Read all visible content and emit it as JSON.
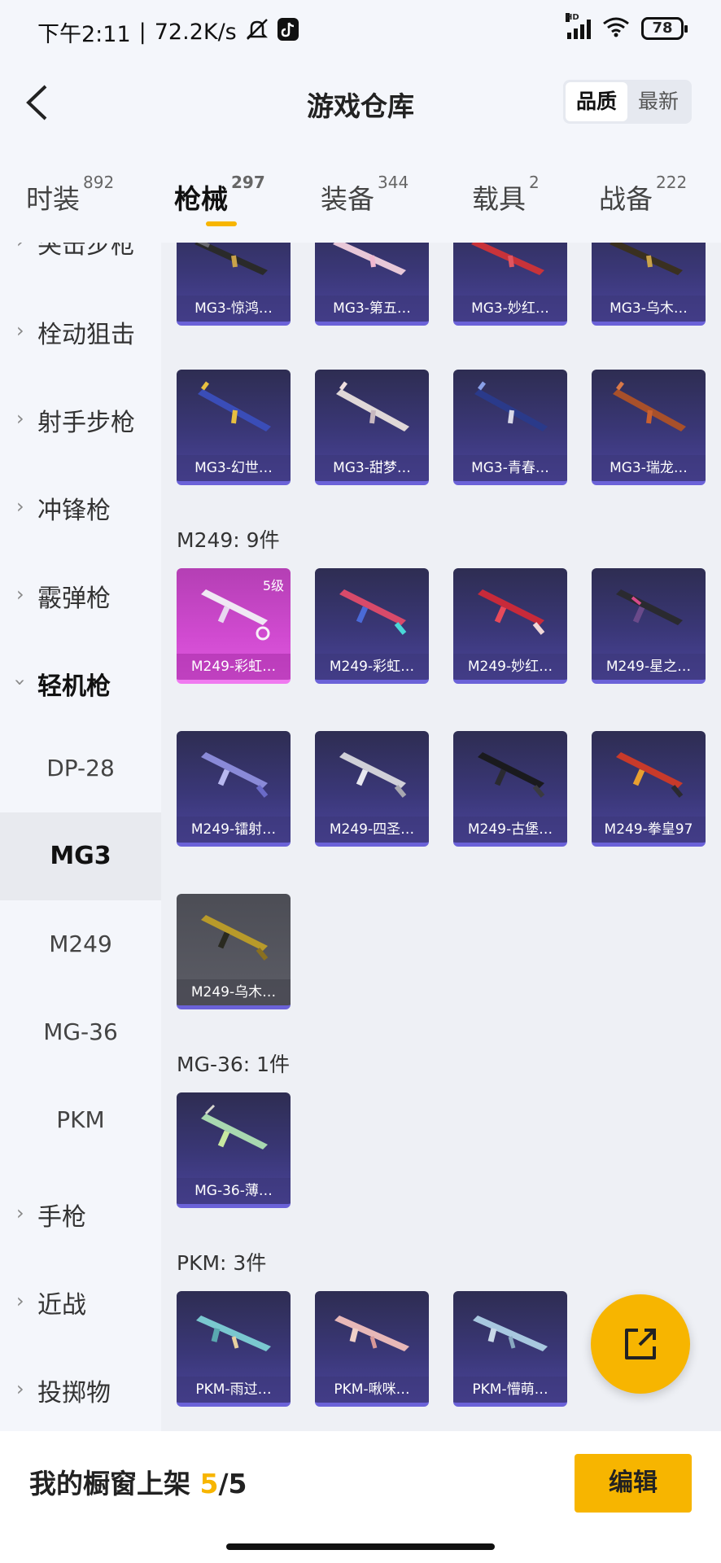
{
  "status": {
    "time": "下午2:11",
    "speed": "72.2K/s",
    "battery": "78",
    "hd": "HD"
  },
  "header": {
    "title": "游戏仓库",
    "sort_options": [
      "品质",
      "最新"
    ],
    "sort_selected": "品质"
  },
  "tabs": [
    {
      "label": "时装",
      "count": "892"
    },
    {
      "label": "枪械",
      "count": "297"
    },
    {
      "label": "装备",
      "count": "344"
    },
    {
      "label": "载具",
      "count": "2"
    },
    {
      "label": "战备",
      "count": "222"
    }
  ],
  "active_tab": "枪械",
  "sidebar": {
    "categories": [
      {
        "label": "突击步枪"
      },
      {
        "label": "栓动狙击"
      },
      {
        "label": "射手步枪"
      },
      {
        "label": "冲锋枪"
      },
      {
        "label": "霰弹枪"
      },
      {
        "label": "轻机枪"
      },
      {
        "label": "手枪"
      },
      {
        "label": "近战"
      },
      {
        "label": "投掷物"
      }
    ],
    "subitems": [
      {
        "label": "DP-28"
      },
      {
        "label": "MG3"
      },
      {
        "label": "M249"
      },
      {
        "label": "MG-36"
      },
      {
        "label": "PKM"
      }
    ],
    "selected_sub": "MG3"
  },
  "sections": {
    "m249_title": "M249: 9件",
    "mg36_title": "MG-36: 1件",
    "pkm_title": "PKM: 3件"
  },
  "cards": {
    "mg3_row1": [
      "MG3-惊鸿…",
      "MG3-第五…",
      "MG3-妙红…",
      "MG3-乌木…"
    ],
    "mg3_row2": [
      "MG3-幻世…",
      "MG3-甜梦…",
      "MG3-青春…",
      "MG3-瑞龙…"
    ],
    "m249_row1": [
      "M249-彩虹…",
      "M249-彩虹…",
      "M249-妙红…",
      "M249-星之…"
    ],
    "m249_row2": [
      "M249-镭射…",
      "M249-四圣…",
      "M249-古堡…",
      "M249-拳皇97"
    ],
    "m249_row3": [
      "M249-乌木…"
    ],
    "mg36_row1": [
      "MG-36-薄…"
    ],
    "pkm_row1": [
      "PKM-雨过…",
      "PKM-啾咪…",
      "PKM-懵萌…"
    ],
    "level_badge": "5级"
  },
  "bottom": {
    "showcase_label": "我的橱窗上架",
    "showcase_current": "5",
    "showcase_total": "/5",
    "edit_label": "编辑"
  },
  "icons": {
    "back": "back-chevron-icon",
    "fab": "share-export-icon",
    "chevron": "chevron-right-icon"
  },
  "colors": {
    "accent": "#f7b500",
    "card_purple": "#3a3777",
    "card_pink": "#d04ad0"
  }
}
